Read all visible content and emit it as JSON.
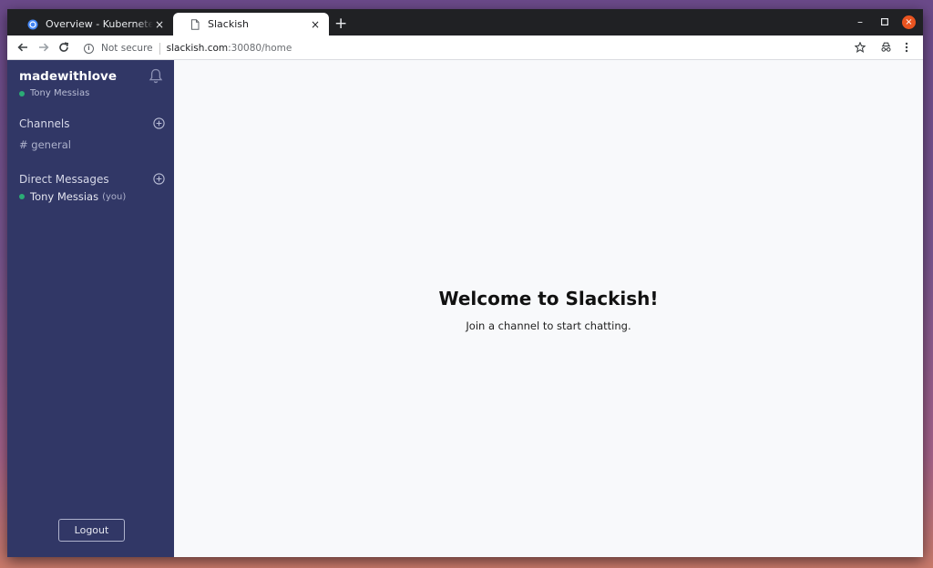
{
  "browser": {
    "tabs": [
      {
        "title": "Overview - Kubernetes Dashboard",
        "active": false
      },
      {
        "title": "Slackish",
        "active": true
      }
    ],
    "address": {
      "security": "Not secure",
      "host": "slackish.com",
      "path": ":30080/home"
    },
    "new_tab_label": "+",
    "close_glyph": "×",
    "window_close_color": "#e95420"
  },
  "sidebar": {
    "team_name": "madewithlove",
    "current_user": "Tony Messias",
    "channels_title": "Channels",
    "channels": [
      {
        "name": "# general"
      }
    ],
    "dm_title": "Direct Messages",
    "direct_messages": [
      {
        "name": "Tony Messias",
        "suffix": "(you)"
      }
    ],
    "logout_label": "Logout",
    "background_color": "#313766",
    "online_color": "#2bac76"
  },
  "main": {
    "welcome_title": "Welcome to Slackish!",
    "welcome_subtitle": "Join a channel to start chatting."
  }
}
